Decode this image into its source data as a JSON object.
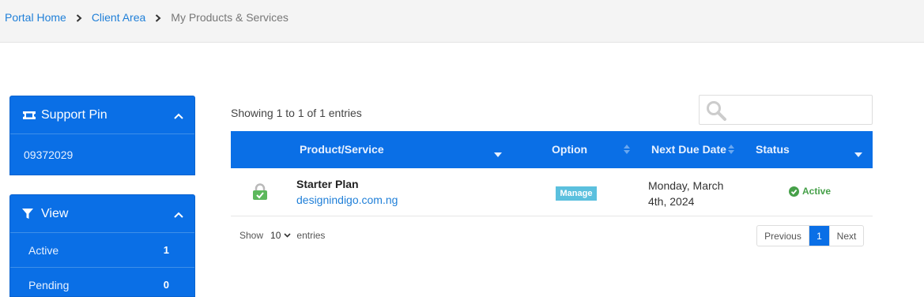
{
  "breadcrumb": {
    "items": [
      "Portal Home",
      "Client Area"
    ],
    "current": "My Products & Services"
  },
  "sidebar": {
    "support_pin": {
      "title": "Support Pin",
      "value": "09372029"
    },
    "view": {
      "title": "View",
      "items": [
        {
          "label": "Active",
          "count": "1"
        },
        {
          "label": "Pending",
          "count": "0"
        }
      ]
    }
  },
  "table": {
    "showing_text": "Showing 1 to 1 of 1 entries",
    "search_placeholder": "",
    "columns": [
      "Product/Service",
      "Option",
      "Next Due Date",
      "Status"
    ],
    "rows": [
      {
        "product": "Starter Plan",
        "domain": "designindigo.com.ng",
        "option_button": "Manage",
        "due_line1": "Monday, March",
        "due_line2": "4th, 2024",
        "status": "Active"
      }
    ],
    "footer": {
      "show_label": "Show",
      "page_length": "10",
      "entries_label": "entries",
      "pagination": {
        "previous": "Previous",
        "current": "1",
        "next": "Next"
      }
    }
  },
  "colors": {
    "primary": "#0a6fe6",
    "link": "#1f7fd8",
    "manage_button": "#5bc0de",
    "status_active": "#46a049"
  }
}
